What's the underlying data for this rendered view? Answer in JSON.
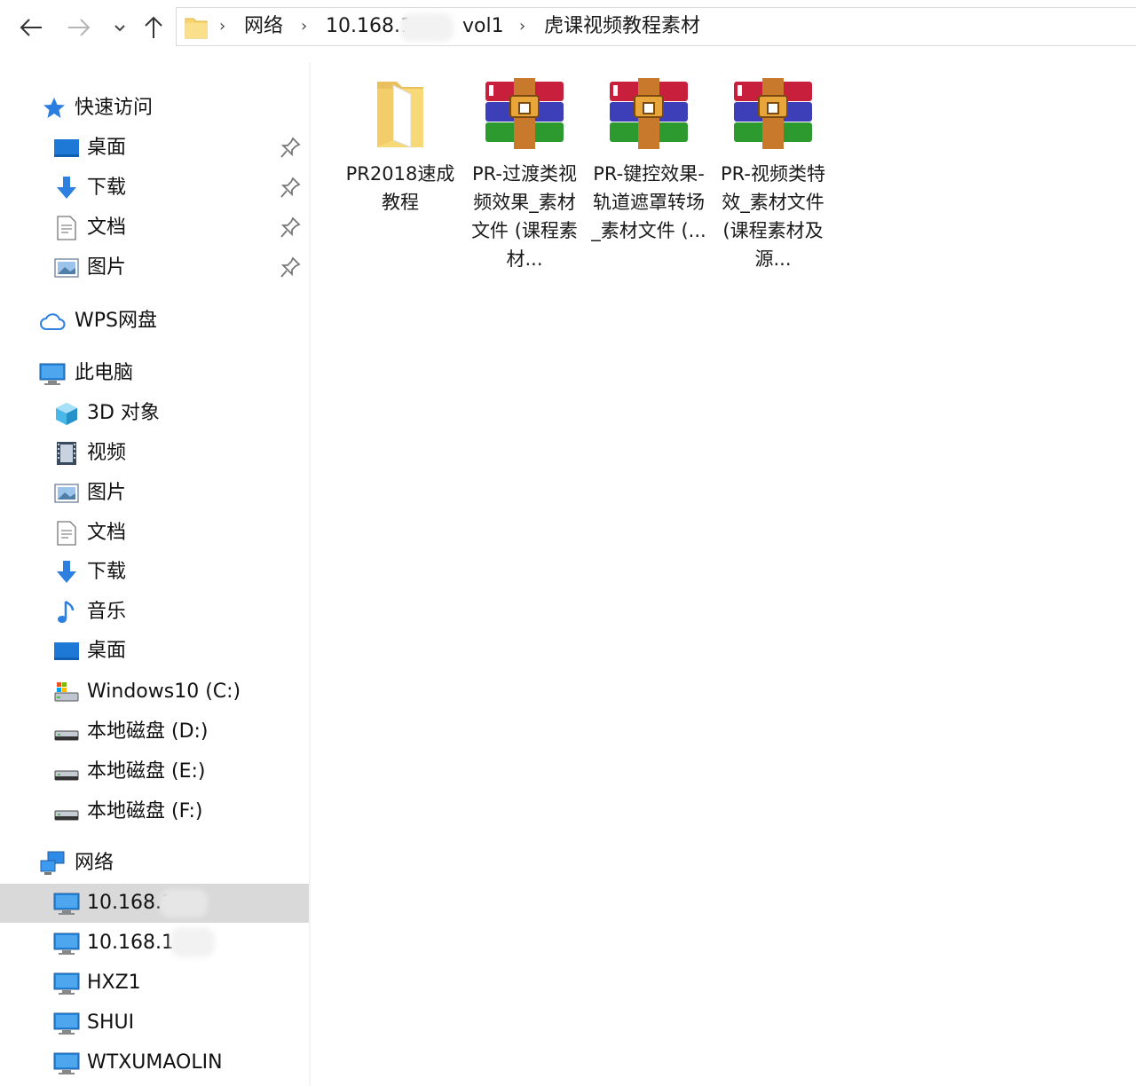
{
  "address": {
    "crumbs": [
      "网络",
      "10.168.1",
      "vol1",
      "虎课视频教程素材"
    ]
  },
  "sidebar": {
    "quick_access": "快速访问",
    "quick_items": [
      {
        "label": "桌面",
        "icon": "desktop-icon"
      },
      {
        "label": "下载",
        "icon": "download-icon"
      },
      {
        "label": "文档",
        "icon": "document-icon"
      },
      {
        "label": "图片",
        "icon": "pictures-icon"
      }
    ],
    "wps": "WPS网盘",
    "this_pc": "此电脑",
    "pc_items": [
      {
        "label": "3D 对象",
        "icon": "3d-objects-icon"
      },
      {
        "label": "视频",
        "icon": "videos-icon"
      },
      {
        "label": "图片",
        "icon": "pictures-icon"
      },
      {
        "label": "文档",
        "icon": "document-icon"
      },
      {
        "label": "下载",
        "icon": "download-icon"
      },
      {
        "label": "音乐",
        "icon": "music-icon"
      },
      {
        "label": "桌面",
        "icon": "desktop-icon"
      },
      {
        "label": "Windows10 (C:)",
        "icon": "system-drive-icon"
      },
      {
        "label": "本地磁盘 (D:)",
        "icon": "drive-icon"
      },
      {
        "label": "本地磁盘 (E:)",
        "icon": "drive-icon"
      },
      {
        "label": "本地磁盘 (F:)",
        "icon": "drive-icon"
      }
    ],
    "network": "网络",
    "network_items": [
      {
        "label": "10.168.1",
        "icon": "computer-icon"
      },
      {
        "label": "10.168.1.",
        "icon": "computer-icon"
      },
      {
        "label": "HXZ1",
        "icon": "computer-icon"
      },
      {
        "label": "SHUI",
        "icon": "computer-icon"
      },
      {
        "label": "WTXUMAOLIN",
        "icon": "computer-icon"
      }
    ]
  },
  "files": [
    {
      "name": "PR2018速成教程",
      "icon": "folder-icon"
    },
    {
      "name": "PR-过渡类视频效果_素材文件 (课程素材...",
      "icon": "winrar-archive-icon"
    },
    {
      "name": "PR-键控效果-轨道遮罩转场_素材文件 (...",
      "icon": "winrar-archive-icon"
    },
    {
      "name": "PR-视频类特效_素材文件 (课程素材及源...",
      "icon": "winrar-archive-icon"
    }
  ]
}
